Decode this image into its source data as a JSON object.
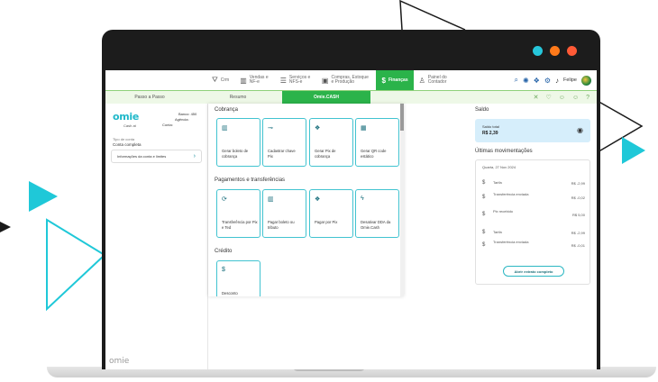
{
  "colors": {
    "accent": "#2bb34a",
    "teal": "#1fc8d8",
    "frame": "#1c1c1c",
    "dot_cyan": "#26c6da",
    "dot_orange": "#ff7a1a",
    "dot_red": "#ff5a36"
  },
  "topnav": {
    "items": [
      {
        "label": "Crm",
        "icon": "funnel-icon"
      },
      {
        "label": "Vendas e NF-e",
        "icon": "bar-chart-icon"
      },
      {
        "label": "Serviços e NFS-e",
        "icon": "services-icon"
      },
      {
        "label": "Compras, Estoque e Produção",
        "icon": "box-icon"
      },
      {
        "label": "Finanças",
        "icon": "dollar-icon"
      },
      {
        "label": "Painel do Contador",
        "icon": "accountant-icon"
      }
    ],
    "user": "Felipe"
  },
  "tabs": [
    "Passo a Passo",
    "Resumo",
    "Omie.CASH"
  ],
  "account": {
    "logo": "omie",
    "logo_sub": "Cash at",
    "banco_label": "Banco:",
    "banco_value": "450",
    "agencia_label": "Agência:",
    "conta_label": "Conta:",
    "type_label": "Tipo de conta",
    "type_value": "Conta completa",
    "info_button": "Informações da conta e limites"
  },
  "sections": {
    "cobranca": "Cobrança",
    "pagamentos": "Pagamentos e transferências",
    "credito": "Crédito"
  },
  "cards": {
    "boleto": "Gerar boleto de cobrança",
    "chave_pix": "Cadastrar chave Pix",
    "pix_cobranca": "Gerar Pix de cobrança",
    "qr": "Gerar QR code estático",
    "transferencia": "Transferência por Pix e Ted",
    "pagar_boleto": "Pagar boleto ou tributo",
    "pagar_pix": "Pagar por Pix",
    "dda": "Desativar DDA da Omie.Cash",
    "desconto": "Desconto"
  },
  "saldo": {
    "title": "Saldo",
    "total_label": "Saldo total",
    "total_value": "R$ 2,39"
  },
  "movimentacoes": {
    "title": "Últimas movimentações",
    "date": "Quarta, 27 Nov 2024",
    "rows": [
      {
        "name": "Tarifa",
        "amount": "R$ -2,99"
      },
      {
        "name": "Transferência enviada",
        "amount": "R$ -0,02"
      },
      {
        "name": "Pix recebido",
        "amount": "R$ 5,00"
      },
      {
        "name": "Tarifa",
        "amount": "R$ -2,99"
      },
      {
        "name": "Transferência enviada",
        "amount": "R$ -0,01"
      }
    ],
    "extrato_button": "Abrir extrato completo"
  },
  "footer_logo": "omie"
}
